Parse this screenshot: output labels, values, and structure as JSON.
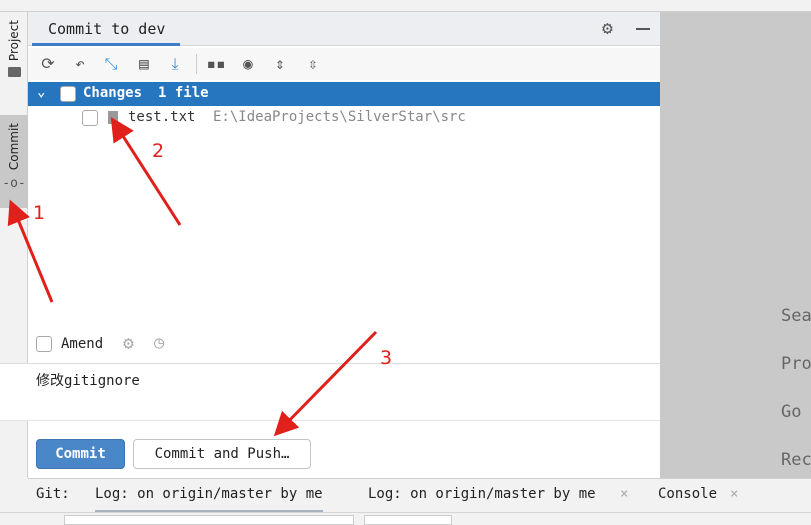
{
  "sidebar": {
    "tabs": [
      {
        "label": "Project",
        "icon": "folder-icon"
      },
      {
        "label": "Commit",
        "icon": "commit-icon",
        "selected": true
      }
    ]
  },
  "panel": {
    "title": "Commit to dev",
    "toolbar": [
      "refresh-icon",
      "rollback-icon",
      "diff-icon",
      "shelve-icon",
      "update-icon",
      "group-by-icon",
      "view-options-icon",
      "expand-all-icon",
      "collapse-all-icon"
    ],
    "changes": {
      "label": "Changes",
      "count": "1 file"
    },
    "files": [
      {
        "name": "test.txt",
        "path": "E:\\IdeaProjects\\SilverStar\\src"
      }
    ],
    "amend_label": "Amend",
    "message": "修改gitignore",
    "commit_label": "Commit",
    "commit_push_label": "Commit and Push…"
  },
  "right": {
    "items": [
      "Sea",
      "Pro",
      "Go",
      "Rec"
    ]
  },
  "bottom": {
    "git_label": "Git:",
    "tabs": [
      {
        "label": "Log: on origin/master by me",
        "active": true
      },
      {
        "label": "Log: on origin/master by me",
        "closable": true
      },
      {
        "label": "Console",
        "closable": true
      }
    ]
  },
  "annotations": {
    "labels": [
      "1",
      "2",
      "3"
    ],
    "color": "#e0201a"
  }
}
